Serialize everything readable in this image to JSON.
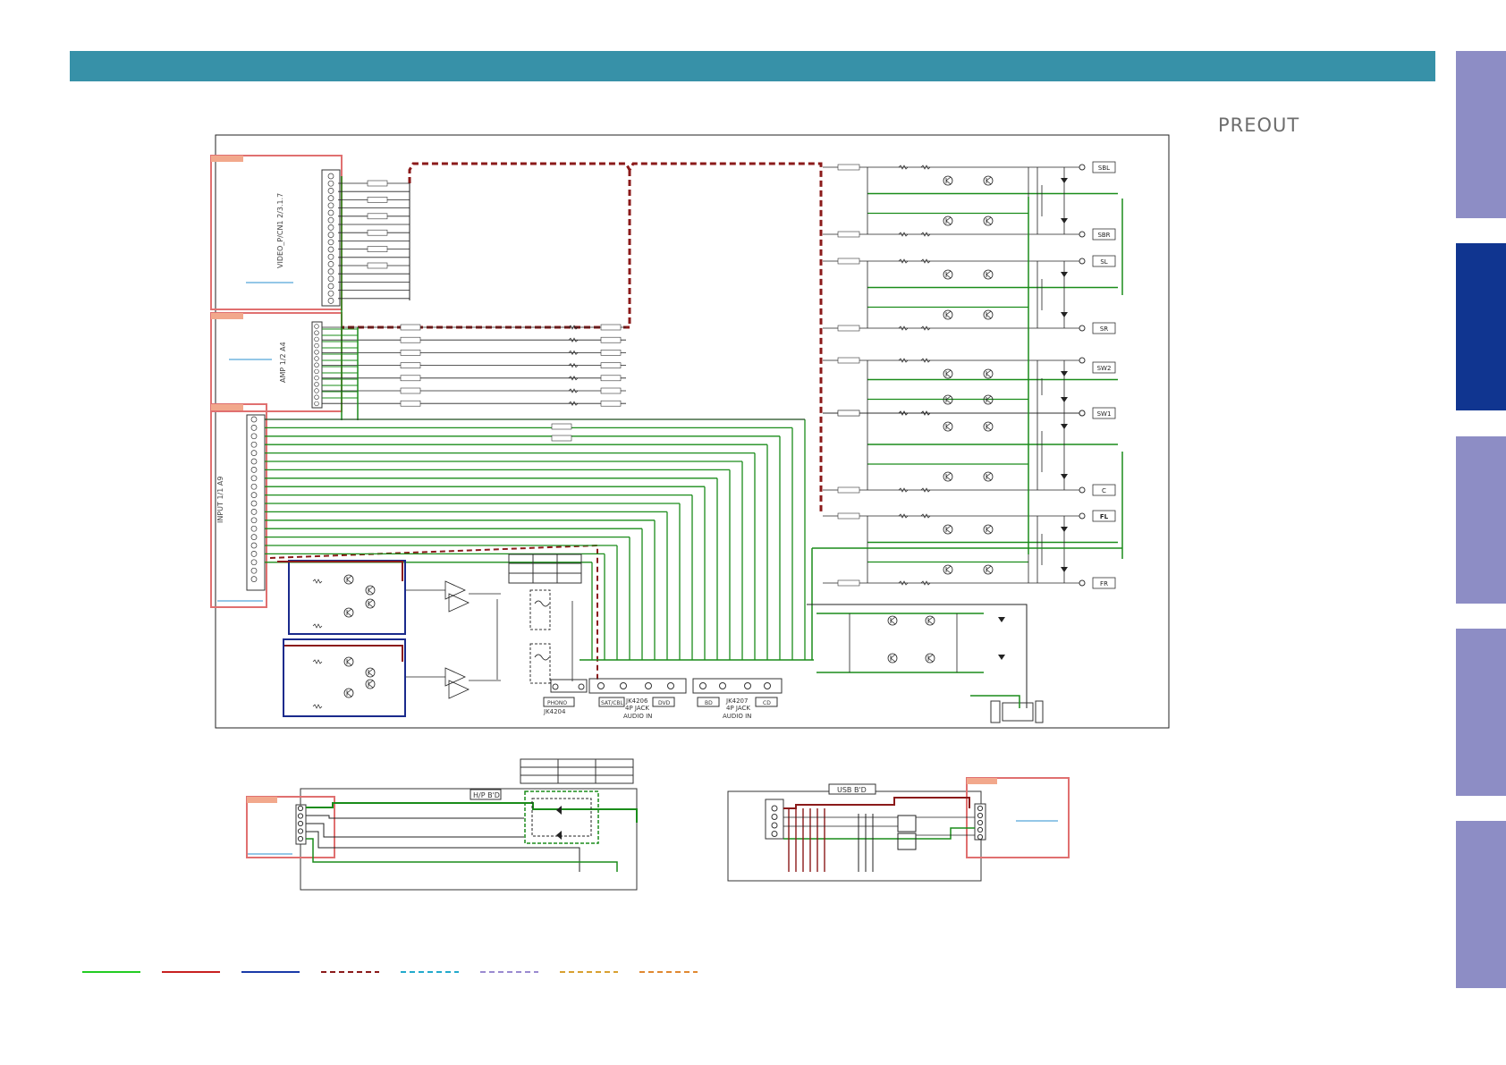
{
  "page": {
    "title": "PREOUT"
  },
  "colors": {
    "header": "#3791a8",
    "tab_inactive": "#8d8dc5",
    "tab_active": "#103590",
    "gnd_line": "#1a8c1a",
    "power_line": "#8b1a1a",
    "neg_line": "#1a2a8c",
    "block_outline": "#e07070"
  },
  "main_schematic": {
    "connectors": {
      "video": "VIDEO_P/CN1 2/3.1.7",
      "amp": "AMP 1/2 A4",
      "input": "INPUT 1/1 A9"
    },
    "outputs": [
      "SBL",
      "SBR",
      "SL",
      "SR",
      "SW2",
      "SW1",
      "C",
      "FL",
      "FR"
    ],
    "jacks": {
      "jk4204": "JK4204",
      "jk4204_label": "PHONO",
      "jk4206": "JK4206",
      "jk4206_sub": "4P JACK",
      "jk4206_caption": "AUDIO IN",
      "jk4206_ports": [
        "SAT/CBL",
        "DVD"
      ],
      "jk4207": "JK4207",
      "jk4207_sub": "4P JACK",
      "jk4207_caption": "AUDIO IN",
      "jk4207_ports": [
        "BD",
        "CD"
      ]
    }
  },
  "hp_board": {
    "label": "H/P B'D"
  },
  "usb_board": {
    "label": "USB B'D"
  },
  "legend": {
    "items": [
      {
        "color": "#22cc22",
        "style": "solid"
      },
      {
        "color": "#c82020",
        "style": "solid"
      },
      {
        "color": "#1a3aa8",
        "style": "solid"
      },
      {
        "color": "#8b1a1a",
        "style": "dashed"
      },
      {
        "color": "#22aacc",
        "style": "dashed"
      },
      {
        "color": "#9a8ad0",
        "style": "dashed"
      },
      {
        "color": "#d8a030",
        "style": "dashed"
      },
      {
        "color": "#e08830",
        "style": "dashed"
      }
    ]
  },
  "side_tabs": [
    {
      "name": "tab-1",
      "active": false
    },
    {
      "name": "tab-2",
      "active": true
    },
    {
      "name": "tab-3",
      "active": false
    },
    {
      "name": "tab-4",
      "active": false
    },
    {
      "name": "tab-5",
      "active": false
    }
  ]
}
